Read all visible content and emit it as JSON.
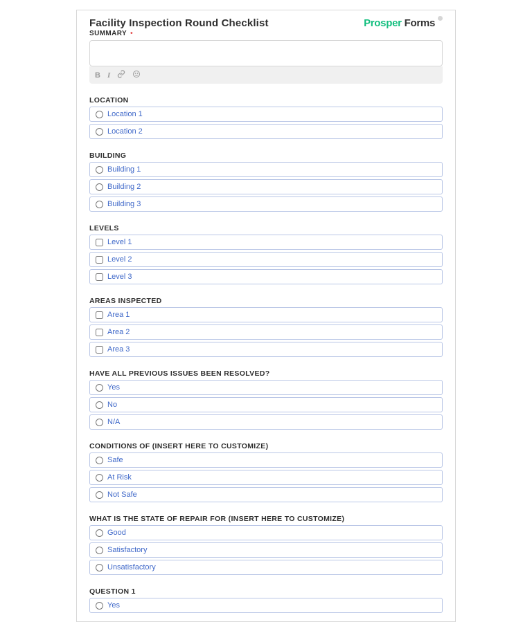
{
  "brand": {
    "part1": "Prosper",
    "part2": "Forms"
  },
  "title": "Facility Inspection Round Checklist",
  "summary": {
    "label": "SUMMARY",
    "required": "•"
  },
  "toolbar": {
    "bold": "B",
    "italic": "I"
  },
  "sections": {
    "location": {
      "label": "LOCATION",
      "type": "radio",
      "options": [
        "Location 1",
        "Location 2"
      ]
    },
    "building": {
      "label": "BUILDING",
      "type": "radio",
      "options": [
        "Building 1",
        "Building 2",
        "Building 3"
      ]
    },
    "levels": {
      "label": "LEVELS",
      "type": "checkbox",
      "options": [
        "Level 1",
        "Level 2",
        "Level 3"
      ]
    },
    "areas": {
      "label": "AREAS INSPECTED",
      "type": "checkbox",
      "options": [
        "Area 1",
        "Area 2",
        "Area 3"
      ]
    },
    "prev_issues": {
      "label": "HAVE ALL PREVIOUS ISSUES BEEN RESOLVED?",
      "type": "radio",
      "options": [
        "Yes",
        "No",
        "N/A"
      ]
    },
    "conditions": {
      "label": "CONDITIONS OF (INSERT HERE TO CUSTOMIZE)",
      "type": "radio",
      "options": [
        "Safe",
        "At Risk",
        "Not Safe"
      ]
    },
    "repair": {
      "label": "WHAT IS THE STATE OF REPAIR FOR (INSERT HERE TO CUSTOMIZE)",
      "type": "radio",
      "options": [
        "Good",
        "Satisfactory",
        "Unsatisfactory"
      ]
    },
    "q1": {
      "label": "QUESTION 1",
      "type": "radio",
      "options": [
        "Yes"
      ]
    }
  }
}
